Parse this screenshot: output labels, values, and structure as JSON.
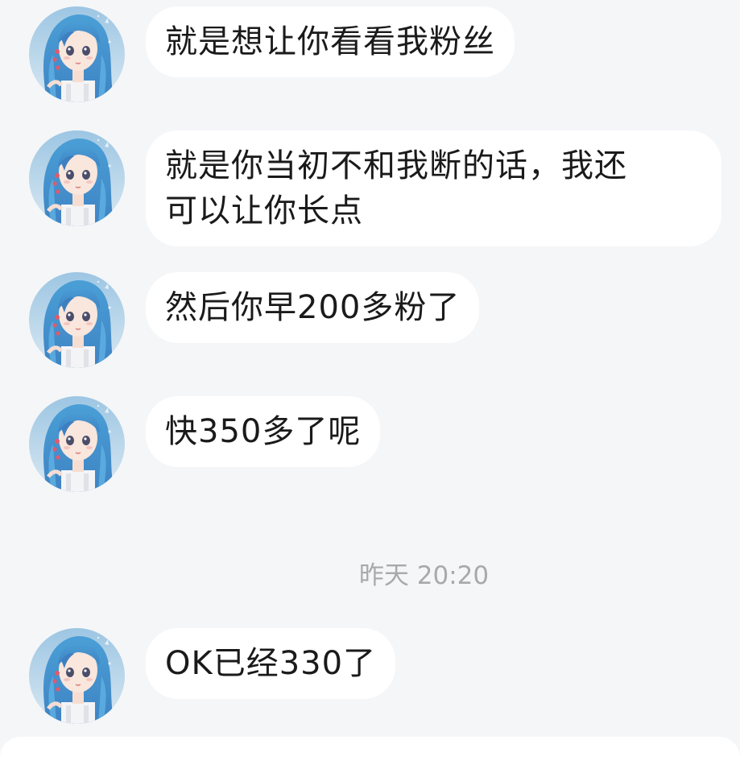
{
  "messages": [
    {
      "text": "就是想让你看看我粉丝"
    },
    {
      "text": "就是你当初不和我断的话，我还\n可以让你长点"
    },
    {
      "text": "然后你早200多粉了"
    },
    {
      "text": "快350多了呢"
    },
    {
      "text": "OK已经330了"
    }
  ],
  "timestamp": "昨天 20:20",
  "avatar": {
    "icon": "anime-girl-avatar-icon"
  },
  "colors": {
    "background": "#f5f6f8",
    "bubble": "#ffffff",
    "text": "#1a1a1a",
    "timestamp": "#a8a9ad"
  }
}
